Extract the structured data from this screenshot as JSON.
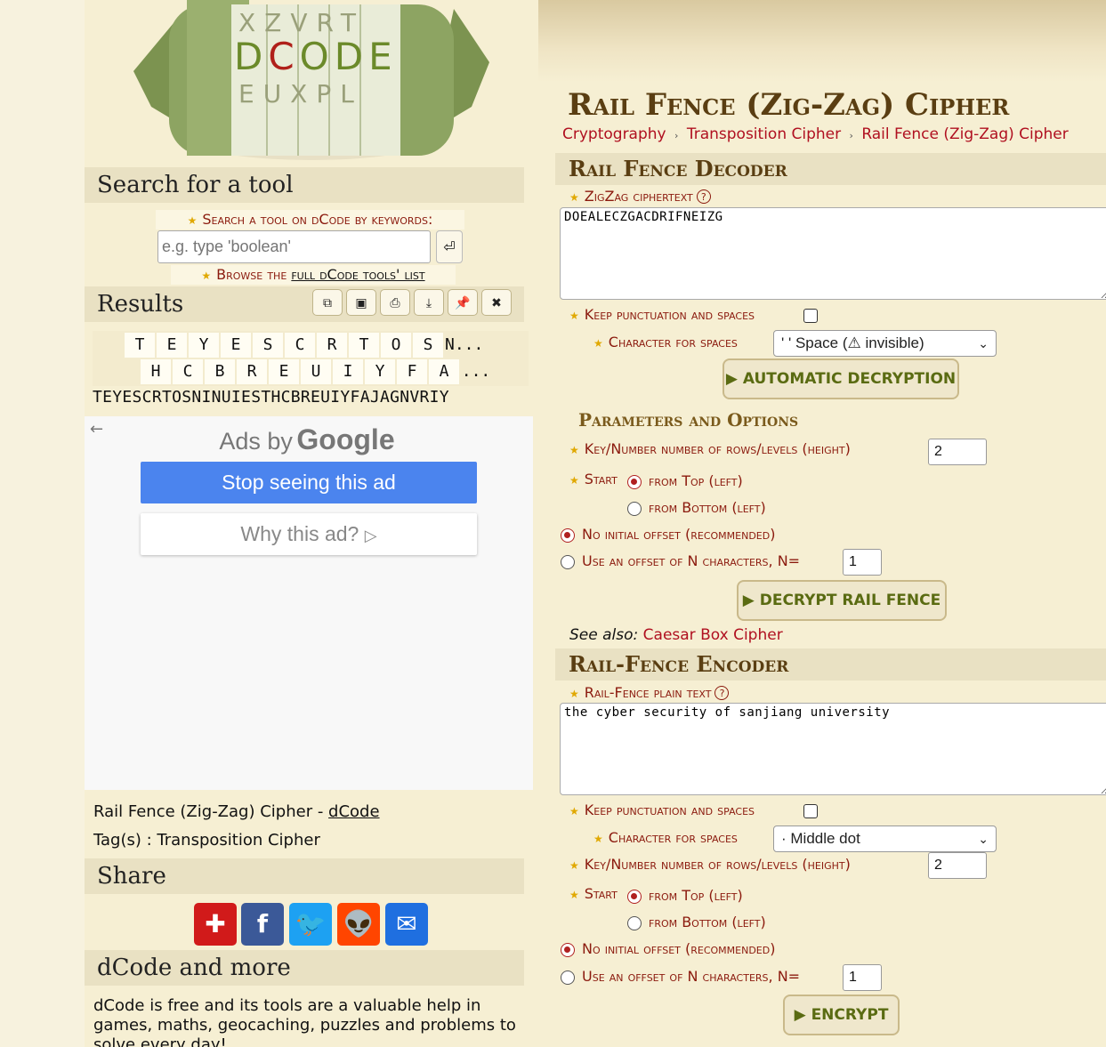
{
  "logo": {
    "drum_text": "DCODE"
  },
  "sidebar": {
    "search_heading": "Search for a tool",
    "search_label": "Search a tool on dCode by keywords:",
    "search_placeholder": "e.g. type 'boolean'",
    "search_go": "⏎",
    "browse_prefix": "Browse the ",
    "browse_link": "full dCode tools' list",
    "results_heading": "Results",
    "result_tools": [
      "copy-icon",
      "floppy-icon",
      "print-icon",
      "download-icon",
      "pin-icon",
      "close-icon"
    ],
    "grid_row1": [
      "T",
      "E",
      "Y",
      "E",
      "S",
      "C",
      "R",
      "T",
      "O",
      "S",
      "N..."
    ],
    "grid_row2": [
      "H",
      "C",
      "B",
      "R",
      "E",
      "U",
      "I",
      "Y",
      "F",
      "A",
      "..."
    ],
    "result_text": "TEYESCRTOSNINUIESTHCBREUIYFAJAGNVRIY",
    "ad": {
      "ads_by": "Ads by",
      "google": "Google",
      "stop_button": "Stop seeing this ad",
      "why_button": "Why this ad?"
    },
    "page_ref_text": "Rail Fence (Zig-Zag) Cipher - ",
    "page_ref_link": "dCode",
    "tags": "Tag(s) : Transposition Cipher",
    "share_heading": "Share",
    "share_buttons": [
      "add-icon",
      "facebook-icon",
      "twitter-icon",
      "reddit-icon",
      "mail-icon"
    ],
    "more_heading": "dCode and more",
    "more_text": "dCode is free and its tools are a valuable help in games, maths, geocaching, puzzles and problems to solve every day!"
  },
  "main": {
    "title": "Rail Fence (Zig-Zag) Cipher",
    "breadcrumb": [
      "Cryptography",
      "Transposition Cipher",
      "Rail Fence (Zig-Zag) Cipher"
    ],
    "decoder": {
      "heading": "Rail Fence Decoder",
      "cipher_label": "ZigZag ciphertext",
      "cipher_value": "DOEALECZGACDRIFNEIZG",
      "keep_punct": "Keep punctuation and spaces",
      "char_spaces": "Character for spaces",
      "char_spaces_value": "' ' Space (⚠ invisible)",
      "auto_button": "▶ AUTOMATIC DECRYPTION",
      "params_heading": "Parameters and Options",
      "key_label": "Key/Number number of rows/levels (height)",
      "key_value": "2",
      "start_label": "Start",
      "from_top": "from Top (left)",
      "from_bottom": "from Bottom (left)",
      "no_offset": "No initial offset (recommended)",
      "use_offset": "Use an offset of N characters, N=",
      "offset_value": "1",
      "decrypt_button": "▶ DECRYPT RAIL FENCE",
      "see_also_label": "See also: ",
      "see_also_link": "Caesar Box Cipher"
    },
    "encoder": {
      "heading": "Rail-Fence Encoder",
      "plain_label": "Rail-Fence plain text",
      "plain_value": "the cyber security of sanjiang university",
      "keep_punct": "Keep punctuation and spaces",
      "char_spaces": "Character for spaces",
      "char_spaces_value": "· Middle dot",
      "key_label": "Key/Number number of rows/levels (height)",
      "key_value": "2",
      "start_label": "Start",
      "from_top": "from Top (left)",
      "from_bottom": "from Bottom (left)",
      "no_offset": "No initial offset (recommended)",
      "use_offset": "Use an offset of N characters, N=",
      "offset_value": "1",
      "encrypt_button": "▶ ENCRYPT"
    }
  }
}
